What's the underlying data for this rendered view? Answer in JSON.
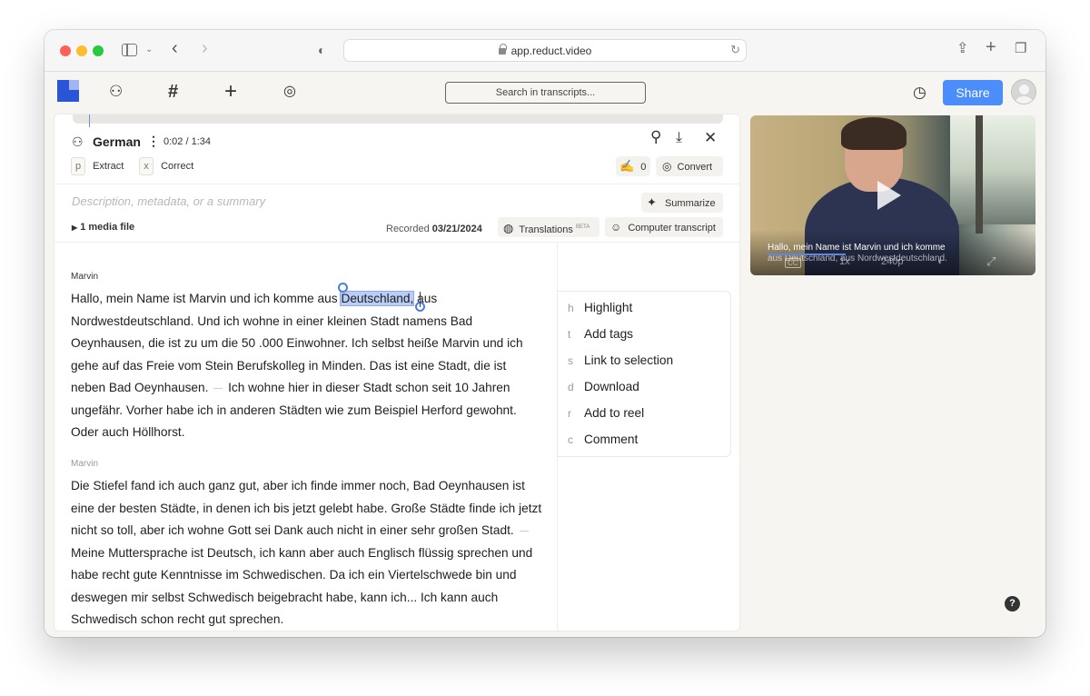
{
  "browser": {
    "url": "app.reduct.video"
  },
  "toolbar": {
    "search_placeholder": "Search in transcripts...",
    "share_label": "Share"
  },
  "transcript": {
    "language": "German",
    "time": "0:02 / 1:34",
    "extract_key": "p",
    "extract_label": "Extract",
    "correct_key": "x",
    "correct_label": "Correct",
    "edits_count": "0",
    "convert_label": "Convert",
    "description_placeholder": "Description, metadata, or a summary",
    "summarize_label": "Summarize",
    "media_file_label": "1 media file",
    "recorded_label": "Recorded",
    "recorded_date": "03/21/2024",
    "translations_label": "Translations",
    "translations_badge": "BETA",
    "computer_transcript_label": "Computer transcript",
    "paragraphs": [
      {
        "speaker": "Marvin",
        "before_selection": "Hallo, mein Name ist Marvin und ich komme aus ",
        "selection": "Deutschland,",
        "after_selection": " aus Nordwestdeutschland. Und ich wohne in einer kleinen Stadt namens Bad Oeynhausen, die ist zu um die 50 .000 Einwohner. Ich selbst heiße Marvin und ich gehe auf das Freie vom Stein Berufskolleg in Minden. Das ist eine Stadt, die ist neben Bad Oeynhausen.",
        "after_pause": "Ich wohne hier in dieser Stadt schon seit 10 Jahren ungefähr. Vorher habe ich in anderen Städten wie zum Beispiel Herford gewohnt. Oder auch Höllhorst."
      },
      {
        "speaker": "Marvin",
        "before_pause": "Die Stiefel fand ich auch ganz gut, aber ich finde immer noch, Bad Oeynhausen ist eine der besten Städte, in denen ich bis jetzt gelebt habe. Große Städte finde ich jetzt nicht so toll, aber ich wohne Gott sei Dank auch nicht in einer sehr großen Stadt.",
        "after_pause": "Meine Muttersprache ist Deutsch, ich kann aber auch Englisch flüssig sprechen und habe recht gute Kenntnisse im Schwedischen. Da ich ein Viertelschwede bin und deswegen mir selbst Schwedisch beigebracht habe, kann ich... Ich kann auch Schwedisch schon recht gut sprechen."
      }
    ]
  },
  "context_menu": [
    {
      "key": "h",
      "label": "Highlight"
    },
    {
      "key": "t",
      "label": "Add tags"
    },
    {
      "key": "s",
      "label": "Link to selection"
    },
    {
      "key": "d",
      "label": "Download"
    },
    {
      "key": "r",
      "label": "Add to reel"
    },
    {
      "key": "c",
      "label": "Comment"
    }
  ],
  "video": {
    "caption_line1": "Hallo, mein Name ist Marvin und ich komme",
    "caption_line2": "aus Deutschland, aus Nordwestdeutschland.",
    "cc_label": "CC",
    "speed_label": "1x",
    "quality_label": "240p",
    "progress_fraction": 0.02
  },
  "help_label": "?",
  "colors": {
    "accent": "#4a8dfb",
    "selection": "#b9cdf6",
    "logo": "#2a55d8"
  }
}
